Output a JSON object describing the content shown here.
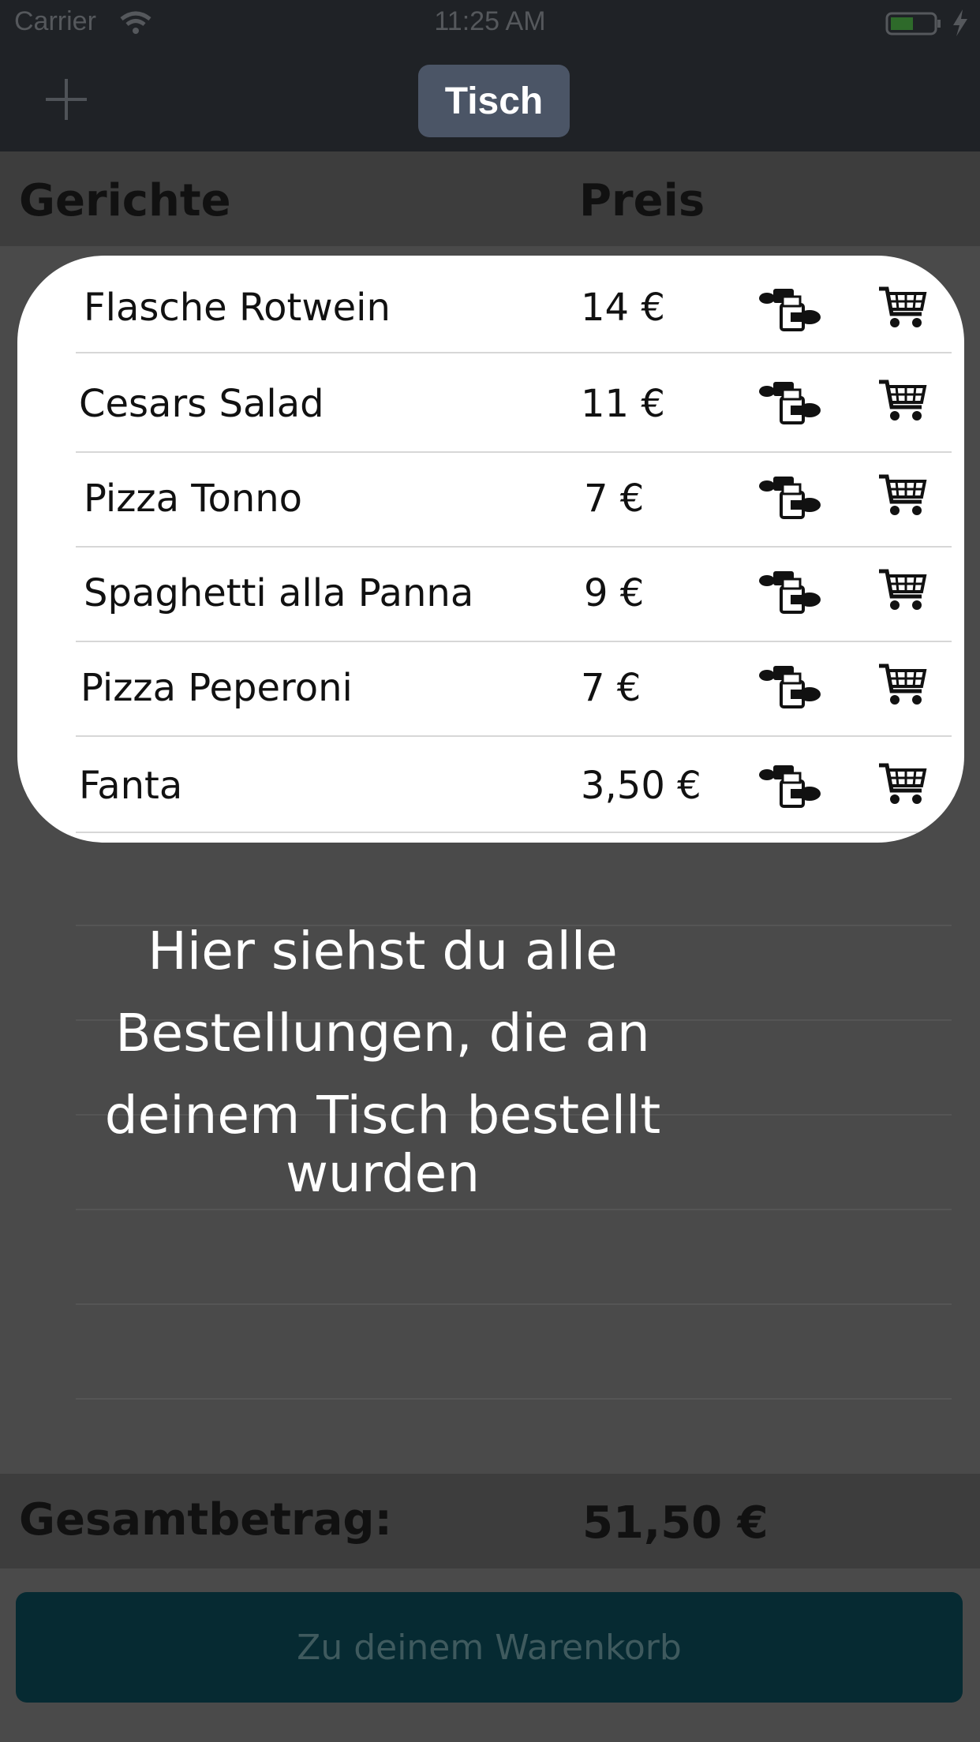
{
  "status_bar": {
    "carrier": "Carrier",
    "time": "11:25 AM"
  },
  "nav": {
    "tab": "Tisch"
  },
  "table": {
    "header": {
      "dishes": "Gerichte",
      "price": "Preis"
    },
    "orders": [
      {
        "name": "Flasche Rotwein",
        "price": "14 €"
      },
      {
        "name": "Cesars Salad",
        "price": "11 €"
      },
      {
        "name": "Pizza Tonno",
        "price": "7 €"
      },
      {
        "name": "Spaghetti alla Panna",
        "price": "9 €"
      },
      {
        "name": "Pizza Peperoni",
        "price": "7 €"
      },
      {
        "name": "Fanta",
        "price": "3,50 €"
      }
    ]
  },
  "hint": {
    "line1": "Hier siehst du alle",
    "line2": "Bestellungen, die an",
    "line3": "deinem Tisch bestellt",
    "line4": "wurden"
  },
  "total": {
    "label": "Gesamtbetrag:",
    "value": "51,50 €"
  },
  "cart_button": {
    "label": "Zu deinem Warenkorb"
  },
  "icons": {
    "add": "plus-icon",
    "split": "split-bill-hands-icon",
    "cart": "shopping-cart-icon",
    "wifi": "wifi-icon",
    "battery": "battery-icon"
  },
  "colors": {
    "nav_background": "#1f2226",
    "tab_pill": "#4b5566",
    "dim_background": "#4a4a4a",
    "button_background": "#062a32",
    "button_text": "#3f5a5e"
  }
}
